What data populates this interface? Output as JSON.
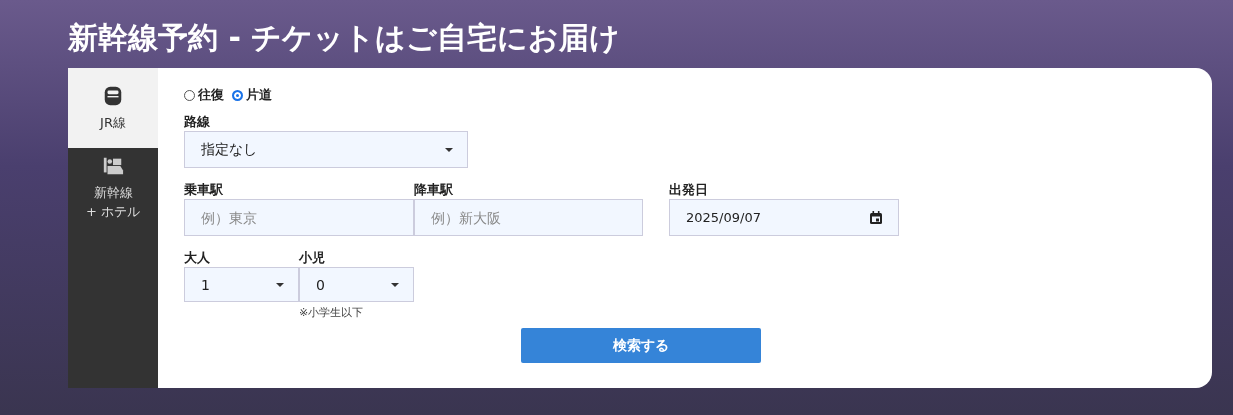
{
  "header": {
    "title": "新幹線予約 - チケットはご自宅にお届け"
  },
  "tabs": [
    {
      "kind": "rail",
      "label_lines": [
        "JR線"
      ],
      "selected": true
    },
    {
      "kind": "hotel",
      "label_lines": [
        "新幹線",
        "+ ホテル"
      ],
      "selected": false
    }
  ],
  "trip_type": [
    {
      "label": "往復",
      "selected": false
    },
    {
      "label": "片道",
      "selected": true
    }
  ],
  "route": {
    "label": "路線",
    "value": "指定なし"
  },
  "departure": {
    "label": "乗車駅",
    "placeholder": "例）東京"
  },
  "arrival": {
    "label": "降車駅",
    "placeholder": "例）新大阪"
  },
  "date": {
    "label": "出発日",
    "value": "2025/09/07"
  },
  "adults": {
    "label": "大人",
    "value": "1"
  },
  "children": {
    "label": "小児",
    "value": "0",
    "note": "※小学生以下"
  },
  "search_button": {
    "label": "検索する"
  }
}
